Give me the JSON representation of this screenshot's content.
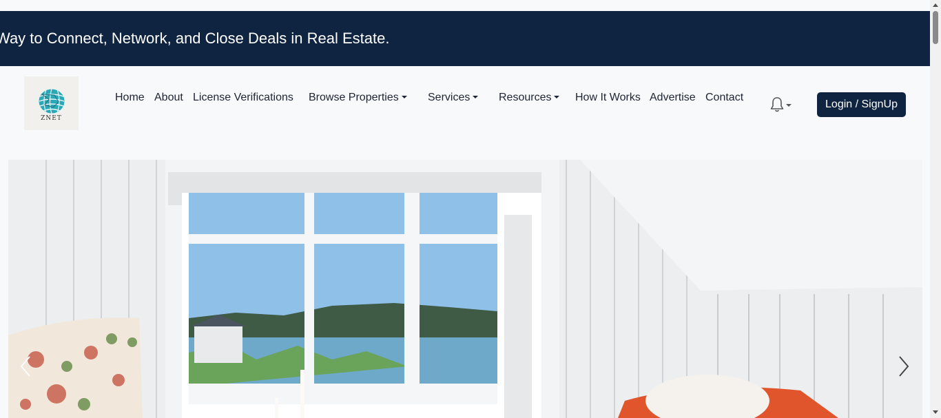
{
  "banner": {
    "text": "Way to Connect, Network, and Close Deals in Real Estate."
  },
  "logo": {
    "text": "ZNET"
  },
  "nav": {
    "home": "Home",
    "about": "About",
    "license": "License Verifications",
    "browse": "Browse Properties",
    "services": "Services",
    "resources": "Resources",
    "how": "How It Works",
    "advertise": "Advertise",
    "contact": "Contact"
  },
  "notifications": {
    "icon": "bell-icon"
  },
  "auth": {
    "login_label": "Login / SignUp"
  },
  "colors": {
    "brand_navy": "#0f2440",
    "page_bg": "#f8f9fb"
  }
}
